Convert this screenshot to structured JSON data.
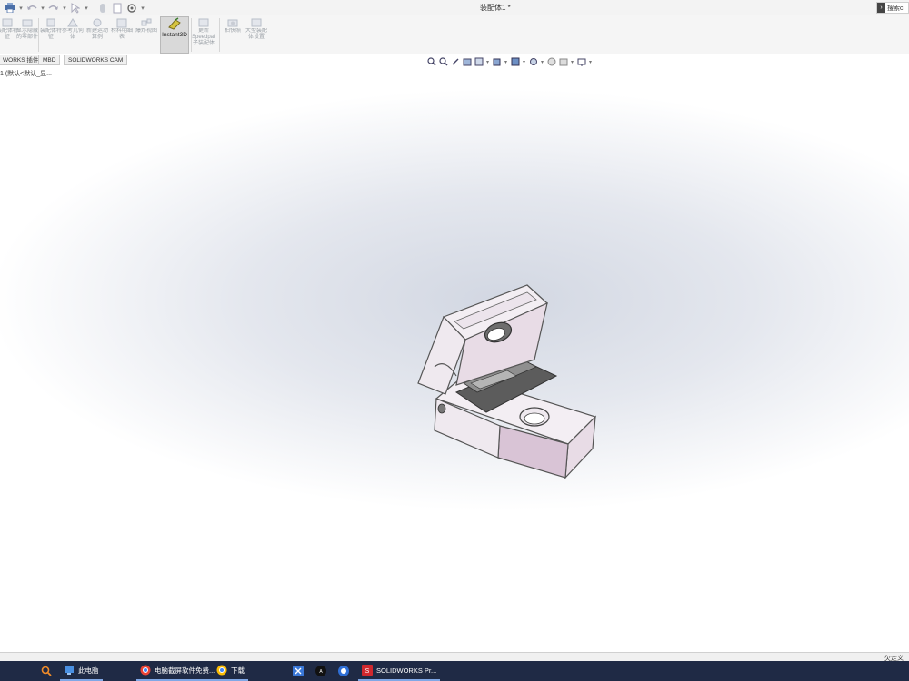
{
  "window": {
    "doc_title": "装配体1 *",
    "search_placeholder": "搜索c"
  },
  "ribbon": {
    "buttons": [
      {
        "label": "装配体特征",
        "icon": "insert-component-icon"
      },
      {
        "label": "显示隐藏的零部件",
        "icon": "show-hidden-icon"
      },
      {
        "label": "装配体特征",
        "icon": "assembly-feature-icon"
      },
      {
        "label": "参考几何体",
        "icon": "reference-geometry-icon"
      },
      {
        "label": "新建运动算例",
        "icon": "motion-study-icon"
      },
      {
        "label": "材料明细表",
        "icon": "bom-icon"
      },
      {
        "label": "爆炸视图",
        "icon": "explode-icon"
      },
      {
        "label": "更新Speedpak子装配体",
        "icon": "speedpak-icon"
      },
      {
        "label": "拍快照",
        "icon": "snapshot-icon"
      },
      {
        "label": "大型装配体设置",
        "icon": "large-assembly-icon"
      }
    ],
    "active_button": {
      "label": "Instant3D",
      "icon": "instant3d-icon"
    }
  },
  "tabs": [
    {
      "label": "WORKS 插件"
    },
    {
      "label": "MBD"
    },
    {
      "label": "SOLIDWORKS CAM"
    }
  ],
  "tree": {
    "text": "1  (默认<默认_显..."
  },
  "status": {
    "text": "欠定义"
  },
  "taskbar": {
    "tasks": [
      {
        "label": "此电脑",
        "icon": "computer-icon"
      },
      {
        "label": "电脑截屏软件免费...",
        "icon": "chrome-icon"
      },
      {
        "label": "下载",
        "icon": "chrome-icon"
      },
      {
        "label": "SOLIDWORKS Pr...",
        "icon": "solidworks-icon"
      }
    ]
  },
  "colors": {
    "taskbar_bg": "#1f2a45",
    "accent": "#7fa7e6",
    "model_face": "#ece4ec",
    "model_side": "#d9c4d6"
  }
}
